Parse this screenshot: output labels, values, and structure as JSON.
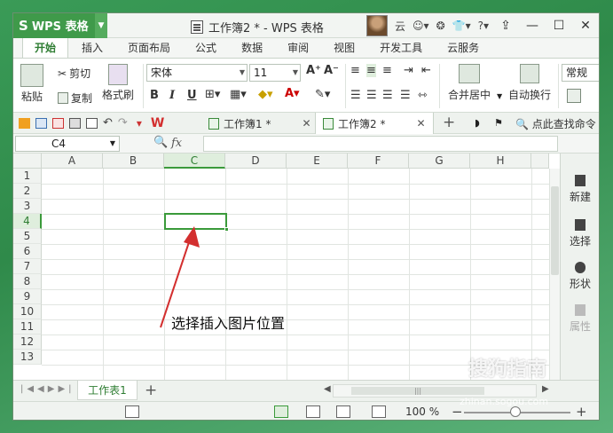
{
  "app": {
    "name": "WPS 表格",
    "logo_glyph": "S",
    "window_title": "工作簿2 * - WPS 表格",
    "account_label": "云",
    "help_label": "?"
  },
  "menu_tabs": [
    "开始",
    "插入",
    "页面布局",
    "公式",
    "数据",
    "审阅",
    "视图",
    "开发工具",
    "云服务"
  ],
  "ribbon": {
    "paste": "粘贴",
    "cut": "剪切",
    "copy": "复制",
    "format_painter": "格式刷",
    "font_name": "宋体",
    "font_size": "11",
    "bold": "B",
    "italic": "I",
    "underline": "U",
    "merge_center": "合并居中",
    "wrap_text": "自动换行",
    "number_format": "常规"
  },
  "doc_tabs": [
    {
      "label": "工作簿1 *",
      "active": false
    },
    {
      "label": "工作簿2 *",
      "active": true
    }
  ],
  "quick_search": "点此查找命令",
  "name_box": "C4",
  "fx_label": "fx",
  "columns": [
    "A",
    "B",
    "C",
    "D",
    "E",
    "F",
    "G",
    "H"
  ],
  "rows": [
    "1",
    "2",
    "3",
    "4",
    "5",
    "6",
    "7",
    "8",
    "9",
    "10",
    "11",
    "12",
    "13"
  ],
  "selected_cell": {
    "col": "C",
    "row": "4"
  },
  "annotation": "选择插入图片位置",
  "right_panel": [
    {
      "label": "新建",
      "enabled": true
    },
    {
      "label": "选择",
      "enabled": true
    },
    {
      "label": "形状",
      "enabled": true
    },
    {
      "label": "属性",
      "enabled": false
    }
  ],
  "sheet_tab": "工作表1",
  "zoom": "100 %",
  "watermark": {
    "brand": "搜狗指南",
    "url": "zhinan.sogou.com"
  },
  "colors": {
    "accent": "#3a9a3a",
    "app_green": "#3f9a4a"
  }
}
